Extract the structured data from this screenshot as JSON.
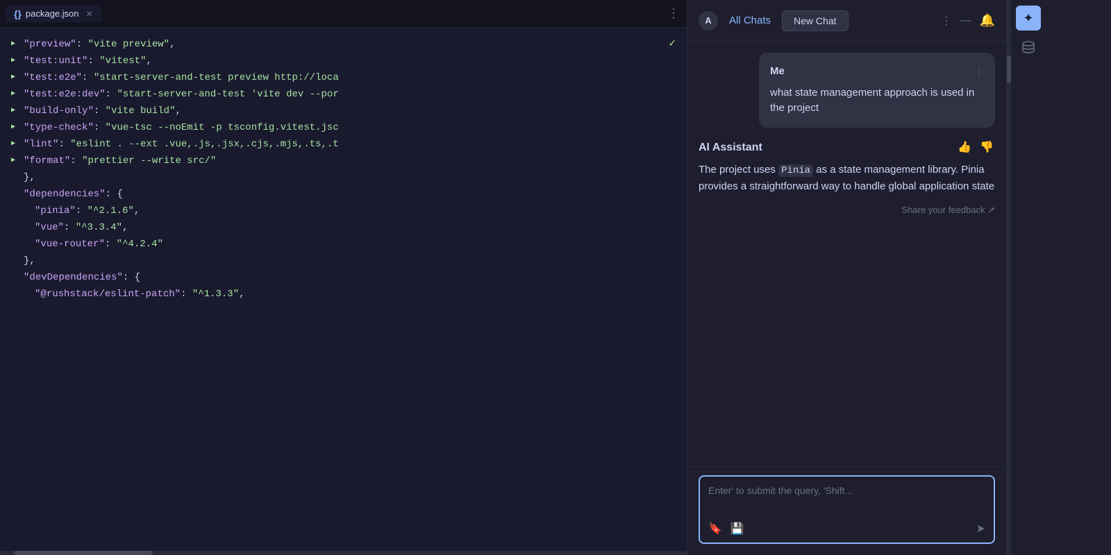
{
  "editor": {
    "tab_label": "package.json",
    "tab_icon": "{}",
    "lines": [
      {
        "runnable": true,
        "content": "  \"preview\": \"vite preview\","
      },
      {
        "runnable": true,
        "content": "  \"test:unit\": \"vitest\","
      },
      {
        "runnable": true,
        "content": "  \"test:e2e\": \"start-server-and-test preview http://loca"
      },
      {
        "runnable": true,
        "content": "  \"test:e2e:dev\": \"start-server-and-test 'vite dev --por"
      },
      {
        "runnable": true,
        "content": "  \"build-only\": \"vite build\","
      },
      {
        "runnable": true,
        "content": "  \"type-check\": \"vue-tsc --noEmit -p tsconfig.vitest.jsc"
      },
      {
        "runnable": true,
        "content": "  \"lint\": \"eslint . --ext .vue,.js,.jsx,.cjs,.mjs,.ts,.t"
      },
      {
        "runnable": true,
        "content": "  \"format\": \"prettier --write src/\""
      }
    ],
    "lines2": [
      {
        "runnable": false,
        "content": "},"
      },
      {
        "runnable": false,
        "content": "\"dependencies\": {"
      },
      {
        "runnable": false,
        "content": "  \"pinia\": \"^2.1.6\","
      },
      {
        "runnable": false,
        "content": "  \"vue\": \"^3.3.4\","
      },
      {
        "runnable": false,
        "content": "  \"vue-router\": \"^4.2.4\""
      },
      {
        "runnable": false,
        "content": "},"
      },
      {
        "runnable": false,
        "content": "\"devDependencies\": {"
      },
      {
        "runnable": false,
        "content": "  \"@rushstack/eslint-patch\": \"^1.3.3\","
      }
    ],
    "checkmark_line": 0
  },
  "chat": {
    "header": {
      "logo_label": "A",
      "all_chats_label": "All Chats",
      "new_chat_label": "New Chat"
    },
    "user_message": {
      "sender": "Me",
      "text": "what state management approach is used in the project"
    },
    "ai_message": {
      "sender": "AI Assistant",
      "body": "The project uses Pinia as a state management library. Pinia provides a straightforward way to handle global application state",
      "feedback_link": "Share your feedback ↗"
    },
    "input": {
      "placeholder": "Enter' to submit the query, 'Shift..."
    }
  },
  "icons": {
    "sparkle": "✦",
    "database": "🗄"
  }
}
